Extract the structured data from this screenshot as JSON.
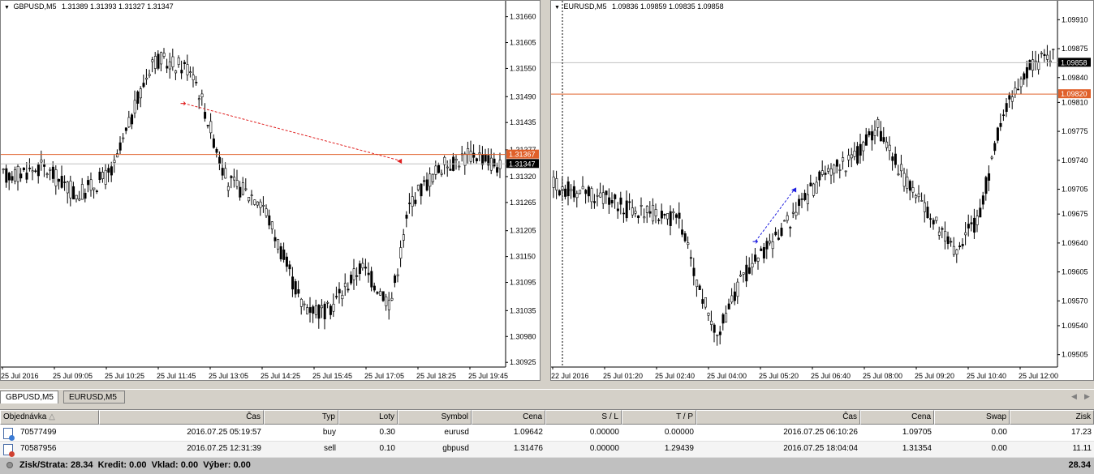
{
  "left_chart": {
    "symbol_tf": "GBPUSD,M5",
    "ohlc": "1.31389 1.31393 1.31327 1.31347",
    "price_labels": [
      "1.31660",
      "1.31605",
      "1.31550",
      "1.31490",
      "1.31435",
      "1.31377",
      "1.31320",
      "1.31265",
      "1.31205",
      "1.31150",
      "1.31095",
      "1.31035",
      "1.30980",
      "1.30925"
    ],
    "time_labels": [
      "25 Jul 2016",
      "25 Jul 09:05",
      "25 Jul 10:25",
      "25 Jul 11:45",
      "25 Jul 13:05",
      "25 Jul 14:25",
      "25 Jul 15:45",
      "25 Jul 17:05",
      "25 Jul 18:25",
      "25 Jul 19:45"
    ],
    "marker_order_price": "1.31367",
    "marker_bid_price": "1.31347",
    "order_line_color": "#e0602a",
    "trade_line_color": "#e02020",
    "price_range": [
      1.30915,
      1.3168
    ],
    "trade": {
      "open_price": 1.31476,
      "close_price": 1.31354,
      "open_time": "25 Jul 12:31",
      "close_time": "25 Jul 18:04"
    }
  },
  "right_chart": {
    "symbol_tf": "EURUSD,M5",
    "ohlc": "1.09836 1.09859 1.09835 1.09858",
    "price_labels": [
      "1.09910",
      "1.09875",
      "1.09840",
      "1.09810",
      "1.09775",
      "1.09740",
      "1.09705",
      "1.09675",
      "1.09640",
      "1.09605",
      "1.09570",
      "1.09540",
      "1.09505"
    ],
    "time_labels": [
      "22 Jul 2016",
      "25 Jul 01:20",
      "25 Jul 02:40",
      "25 Jul 04:00",
      "25 Jul 05:20",
      "25 Jul 06:40",
      "25 Jul 08:00",
      "25 Jul 09:20",
      "25 Jul 10:40",
      "25 Jul 12:00"
    ],
    "marker_order_price": "1.09820",
    "marker_bid_price": "1.09858",
    "order_line_color": "#e0602a",
    "trade_line_color": "#2020e0",
    "price_range": [
      1.0949,
      1.09925
    ],
    "trade": {
      "open_price": 1.09642,
      "close_price": 1.09705,
      "open_time": "25 Jul 05:19",
      "close_time": "25 Jul 06:10"
    }
  },
  "tabs": [
    "GBPUSD,M5",
    "EURUSD,M5"
  ],
  "table": {
    "headers": [
      "Objednávka",
      "Čas",
      "Typ",
      "Loty",
      "Symbol",
      "Cena",
      "S / L",
      "T / P",
      "Čas",
      "Cena",
      "Swap",
      "Zisk"
    ],
    "rows": [
      [
        "70577499",
        "2016.07.25 05:19:57",
        "buy",
        "0.30",
        "eurusd",
        "1.09642",
        "0.00000",
        "0.00000",
        "2016.07.25 06:10:26",
        "1.09705",
        "0.00",
        "17.23"
      ],
      [
        "70587956",
        "2016.07.25 12:31:39",
        "sell",
        "0.10",
        "gbpusd",
        "1.31476",
        "0.00000",
        "1.29439",
        "2016.07.25 18:04:04",
        "1.31354",
        "0.00",
        "11.11"
      ]
    ],
    "summary": "Zisk/Strata: 28.34  Kredit: 0.00  Vklad: 0.00  Výber: 0.00",
    "summary_total": "28.34"
  }
}
